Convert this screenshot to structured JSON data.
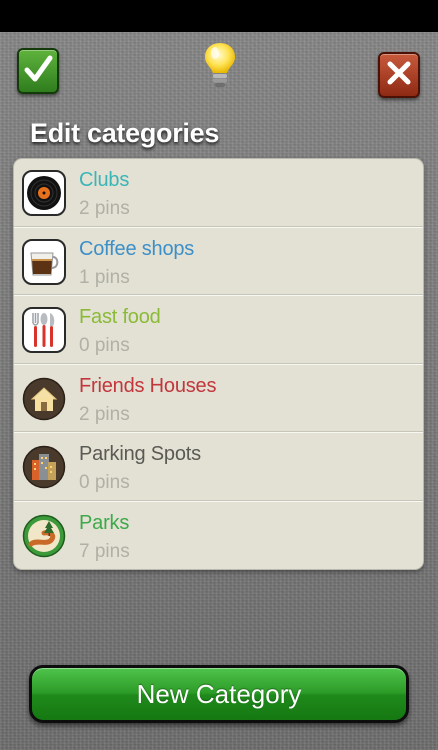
{
  "header": {
    "title": "Edit categories"
  },
  "categories": [
    {
      "name": "Clubs",
      "count": "2 pins",
      "color": "#3bb5b8",
      "icon": "vinyl-record-icon"
    },
    {
      "name": "Coffee shops",
      "count": "1 pins",
      "color": "#3d8fc8",
      "icon": "coffee-cup-icon"
    },
    {
      "name": "Fast food",
      "count": "0 pins",
      "color": "#8bbb36",
      "icon": "cutlery-icon"
    },
    {
      "name": "Friends Houses",
      "count": "2 pins",
      "color": "#c2363c",
      "icon": "house-icon"
    },
    {
      "name": "Parking Spots",
      "count": "0 pins",
      "color": "#5a5a55",
      "icon": "buildings-icon"
    },
    {
      "name": "Parks",
      "count": "7 pins",
      "color": "#3ea84a",
      "icon": "park-road-icon"
    }
  ],
  "footer": {
    "new_category_label": "New Category"
  },
  "colors": {
    "accent_green": "#2c9b27",
    "cancel_red": "#b04a2c",
    "list_background": "#e2e1d4",
    "count_text": "#b1b0a6"
  }
}
